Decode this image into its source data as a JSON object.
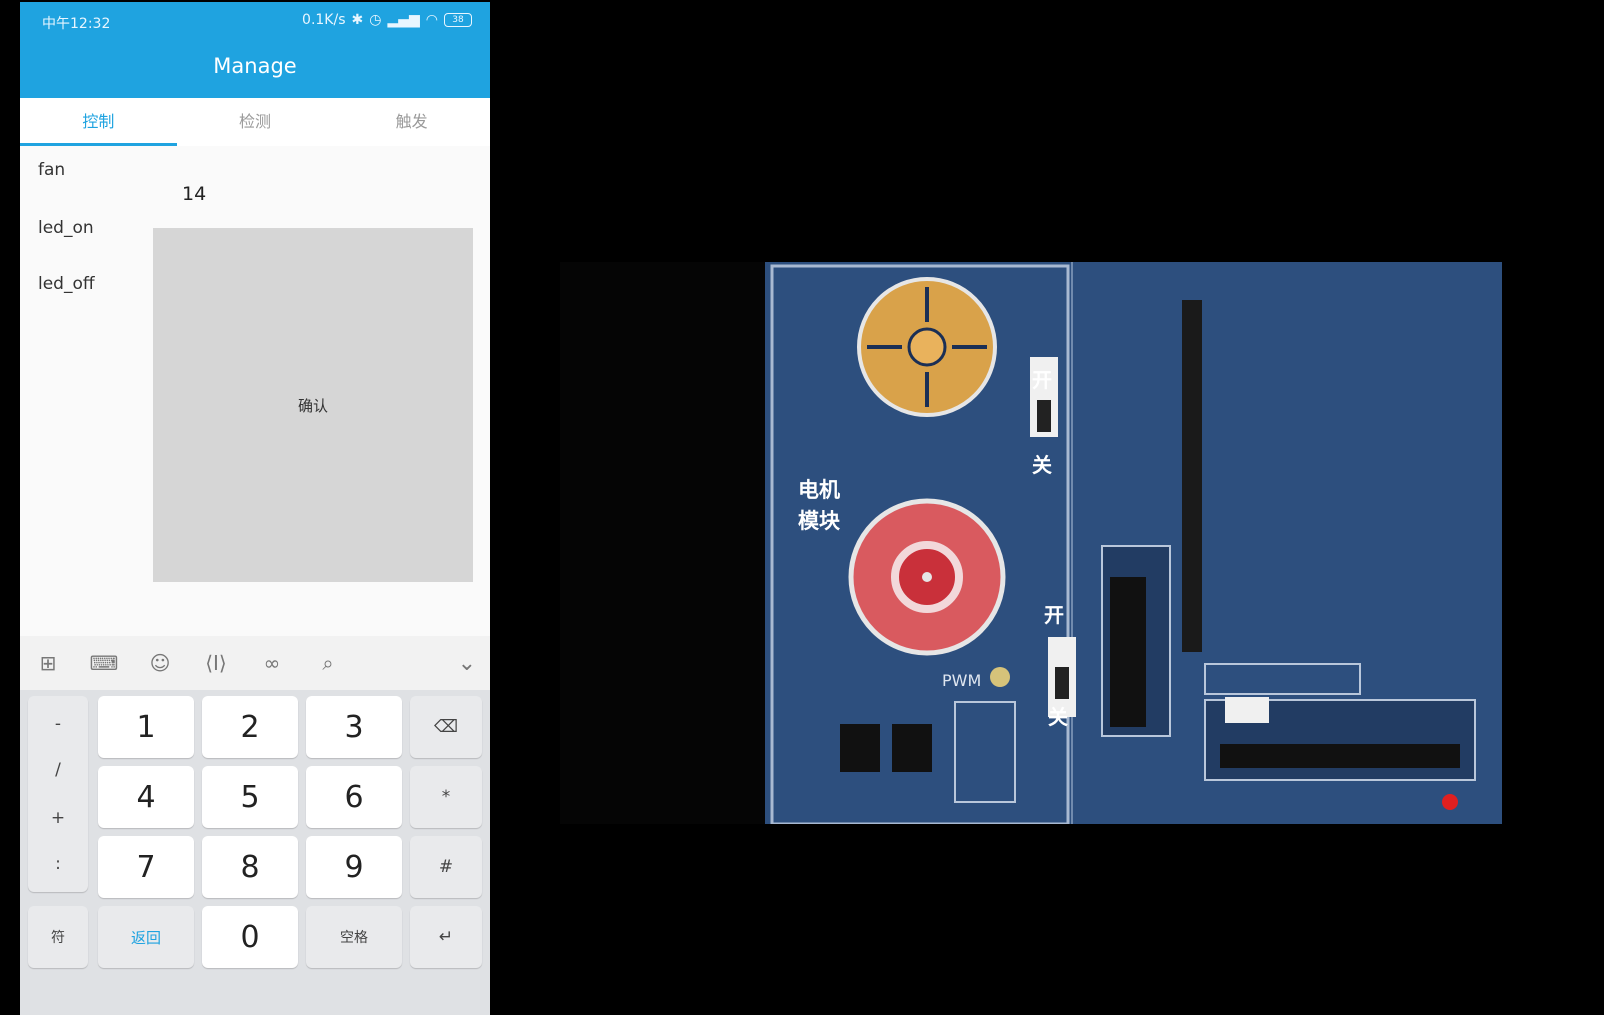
{
  "status_bar": {
    "time": "中午12:32",
    "network": "0.1K/s",
    "icons": [
      "bluetooth-icon",
      "alarm-icon",
      "signal-icon",
      "wifi-icon"
    ],
    "battery": "38"
  },
  "app_bar": {
    "title": "Manage"
  },
  "tabs": [
    {
      "label": "控制",
      "active": true
    },
    {
      "label": "检测",
      "active": false
    },
    {
      "label": "触发",
      "active": false
    }
  ],
  "commands": [
    "fan",
    "led_on",
    "led_off"
  ],
  "value_input": "14",
  "confirm_label": "确认",
  "keyboard": {
    "toolbar_icons": [
      "grid-icon",
      "keyboard-icon",
      "emoji-icon",
      "cursor-icon",
      "link-icon",
      "search-icon"
    ],
    "collapse_icon": "chevron-down-icon",
    "symbols": [
      "-",
      "/",
      "+",
      ":"
    ],
    "digits": [
      "1",
      "2",
      "3",
      "4",
      "5",
      "6",
      "7",
      "8",
      "9",
      "0"
    ],
    "backspace_icon": "backspace-icon",
    "asterisk": "*",
    "hash": "#",
    "symbol_key": "符",
    "back_key": "返回",
    "space_key": "空格",
    "enter_icon": "enter-icon"
  },
  "board_labels": {
    "switch_on": "开",
    "switch_off": "关",
    "motor_module_line1": "电机",
    "motor_module_line2": "模块",
    "pwm": "PWM"
  },
  "colors": {
    "accent": "#1fa3e0",
    "pcb_blue": "#2d4f7e",
    "confirm_bg": "#d6d6d6"
  }
}
